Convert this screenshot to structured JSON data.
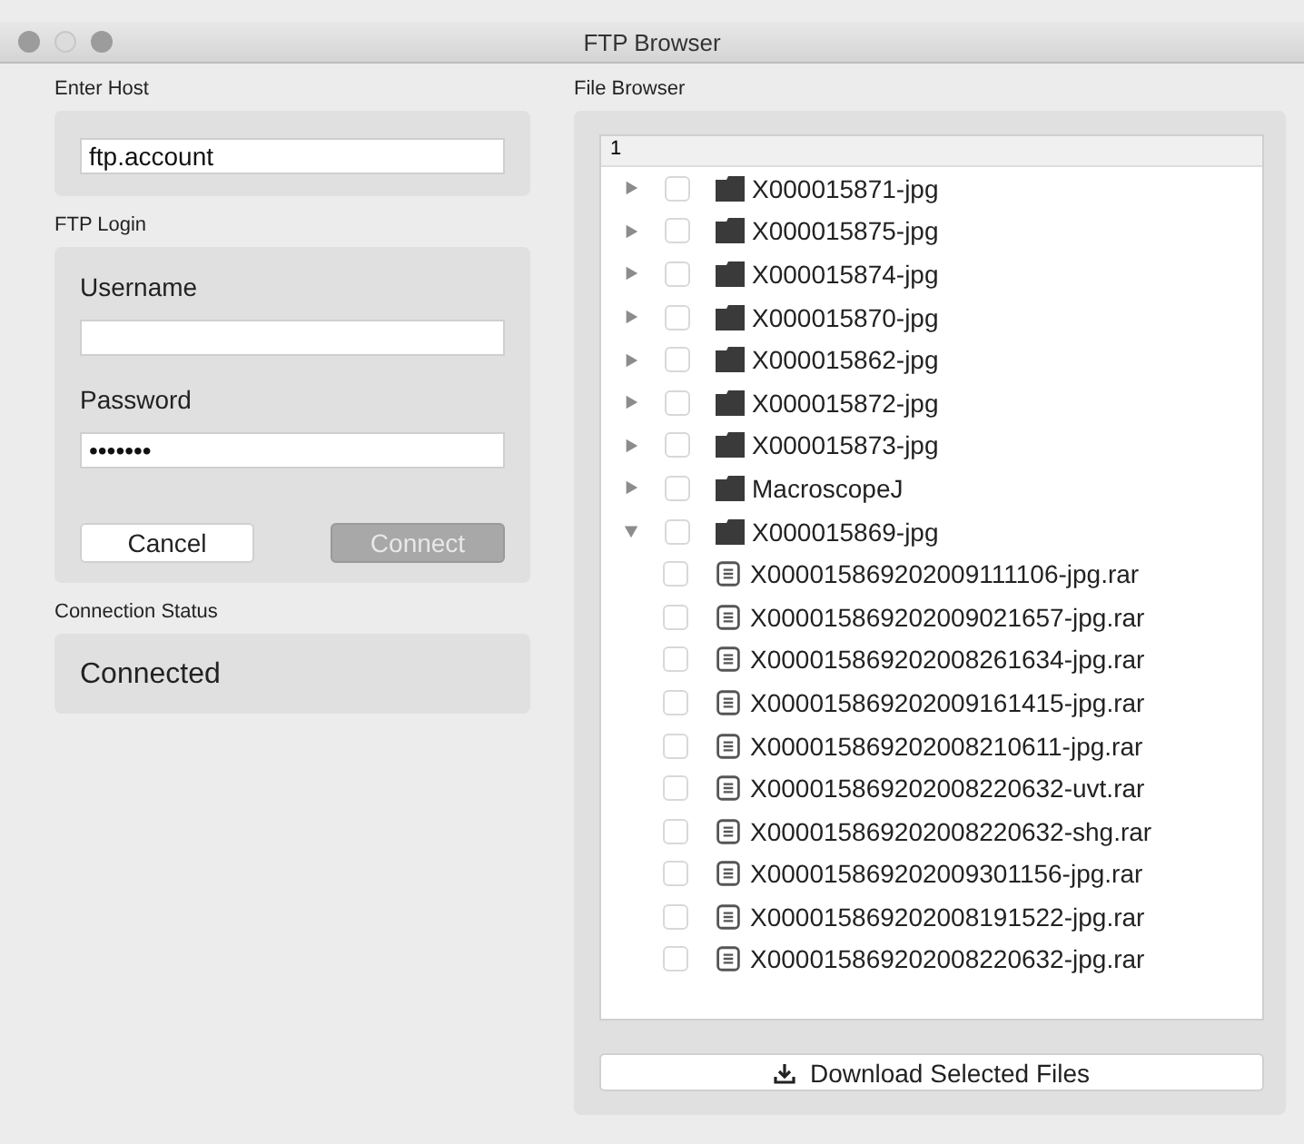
{
  "window": {
    "title": "FTP Browser"
  },
  "host": {
    "label": "Enter Host",
    "value": "ftp.account"
  },
  "login": {
    "label": "FTP Login",
    "username_label": "Username",
    "password_label": "Password",
    "password_value": "•••••••",
    "buttons": [
      {
        "label": "Cancel",
        "disabled": false
      },
      {
        "label": "Connect",
        "disabled": true
      }
    ]
  },
  "status": {
    "label": "Connection Status",
    "text": "Connected"
  },
  "file_browser": {
    "label": "File Browser",
    "header": "1",
    "items": [
      {
        "kind": "folder",
        "name": "X000015871-jpg",
        "expanded": false,
        "checked": false
      },
      {
        "kind": "folder",
        "name": "X000015875-jpg",
        "expanded": false,
        "checked": false
      },
      {
        "kind": "folder",
        "name": "X000015874-jpg",
        "expanded": false,
        "checked": false
      },
      {
        "kind": "folder",
        "name": "X000015870-jpg",
        "expanded": false,
        "checked": false
      },
      {
        "kind": "folder",
        "name": "X000015862-jpg",
        "expanded": false,
        "checked": false
      },
      {
        "kind": "folder",
        "name": "X000015872-jpg",
        "expanded": false,
        "checked": false
      },
      {
        "kind": "folder",
        "name": "X000015873-jpg",
        "expanded": false,
        "checked": false
      },
      {
        "kind": "folder",
        "name": "MacroscopeJ",
        "expanded": false,
        "checked": false
      },
      {
        "kind": "folder",
        "name": "X000015869-jpg",
        "expanded": true,
        "checked": false,
        "children": [
          {
            "kind": "file",
            "name": "X000015869202009111106-jpg.rar",
            "checked": false
          },
          {
            "kind": "file",
            "name": "X000015869202009021657-jpg.rar",
            "checked": false
          },
          {
            "kind": "file",
            "name": "X000015869202008261634-jpg.rar",
            "checked": false
          },
          {
            "kind": "file",
            "name": "X000015869202009161415-jpg.rar",
            "checked": false
          },
          {
            "kind": "file",
            "name": "X000015869202008210611-jpg.rar",
            "checked": false
          },
          {
            "kind": "file",
            "name": "X000015869202008220632-uvt.rar",
            "checked": false
          },
          {
            "kind": "file",
            "name": "X000015869202008220632-shg.rar",
            "checked": false
          },
          {
            "kind": "file",
            "name": "X000015869202009301156-jpg.rar",
            "checked": false
          },
          {
            "kind": "file",
            "name": "X000015869202008191522-jpg.rar",
            "checked": false
          },
          {
            "kind": "file",
            "name": "X000015869202008220632-jpg.rar",
            "checked": false
          }
        ]
      }
    ]
  },
  "download_button": {
    "label": "Download Selected Files"
  }
}
